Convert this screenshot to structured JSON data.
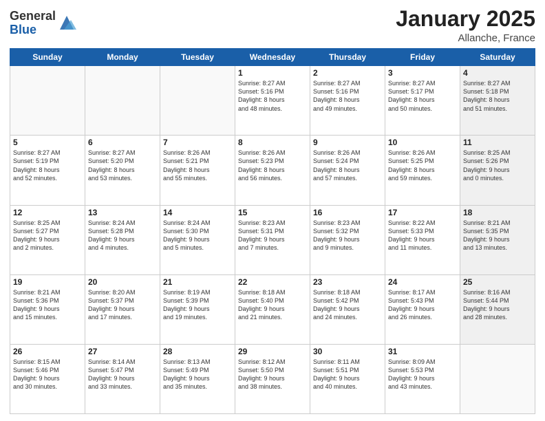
{
  "header": {
    "logo_general": "General",
    "logo_blue": "Blue",
    "month": "January 2025",
    "location": "Allanche, France"
  },
  "weekdays": [
    "Sunday",
    "Monday",
    "Tuesday",
    "Wednesday",
    "Thursday",
    "Friday",
    "Saturday"
  ],
  "weeks": [
    [
      {
        "day": "",
        "info": "",
        "empty": true
      },
      {
        "day": "",
        "info": "",
        "empty": true
      },
      {
        "day": "",
        "info": "",
        "empty": true
      },
      {
        "day": "1",
        "info": "Sunrise: 8:27 AM\nSunset: 5:16 PM\nDaylight: 8 hours\nand 48 minutes.",
        "empty": false
      },
      {
        "day": "2",
        "info": "Sunrise: 8:27 AM\nSunset: 5:16 PM\nDaylight: 8 hours\nand 49 minutes.",
        "empty": false
      },
      {
        "day": "3",
        "info": "Sunrise: 8:27 AM\nSunset: 5:17 PM\nDaylight: 8 hours\nand 50 minutes.",
        "empty": false
      },
      {
        "day": "4",
        "info": "Sunrise: 8:27 AM\nSunset: 5:18 PM\nDaylight: 8 hours\nand 51 minutes.",
        "empty": false,
        "shaded": true
      }
    ],
    [
      {
        "day": "5",
        "info": "Sunrise: 8:27 AM\nSunset: 5:19 PM\nDaylight: 8 hours\nand 52 minutes.",
        "empty": false
      },
      {
        "day": "6",
        "info": "Sunrise: 8:27 AM\nSunset: 5:20 PM\nDaylight: 8 hours\nand 53 minutes.",
        "empty": false
      },
      {
        "day": "7",
        "info": "Sunrise: 8:26 AM\nSunset: 5:21 PM\nDaylight: 8 hours\nand 55 minutes.",
        "empty": false
      },
      {
        "day": "8",
        "info": "Sunrise: 8:26 AM\nSunset: 5:23 PM\nDaylight: 8 hours\nand 56 minutes.",
        "empty": false
      },
      {
        "day": "9",
        "info": "Sunrise: 8:26 AM\nSunset: 5:24 PM\nDaylight: 8 hours\nand 57 minutes.",
        "empty": false
      },
      {
        "day": "10",
        "info": "Sunrise: 8:26 AM\nSunset: 5:25 PM\nDaylight: 8 hours\nand 59 minutes.",
        "empty": false
      },
      {
        "day": "11",
        "info": "Sunrise: 8:25 AM\nSunset: 5:26 PM\nDaylight: 9 hours\nand 0 minutes.",
        "empty": false,
        "shaded": true
      }
    ],
    [
      {
        "day": "12",
        "info": "Sunrise: 8:25 AM\nSunset: 5:27 PM\nDaylight: 9 hours\nand 2 minutes.",
        "empty": false
      },
      {
        "day": "13",
        "info": "Sunrise: 8:24 AM\nSunset: 5:28 PM\nDaylight: 9 hours\nand 4 minutes.",
        "empty": false
      },
      {
        "day": "14",
        "info": "Sunrise: 8:24 AM\nSunset: 5:30 PM\nDaylight: 9 hours\nand 5 minutes.",
        "empty": false
      },
      {
        "day": "15",
        "info": "Sunrise: 8:23 AM\nSunset: 5:31 PM\nDaylight: 9 hours\nand 7 minutes.",
        "empty": false
      },
      {
        "day": "16",
        "info": "Sunrise: 8:23 AM\nSunset: 5:32 PM\nDaylight: 9 hours\nand 9 minutes.",
        "empty": false
      },
      {
        "day": "17",
        "info": "Sunrise: 8:22 AM\nSunset: 5:33 PM\nDaylight: 9 hours\nand 11 minutes.",
        "empty": false
      },
      {
        "day": "18",
        "info": "Sunrise: 8:21 AM\nSunset: 5:35 PM\nDaylight: 9 hours\nand 13 minutes.",
        "empty": false,
        "shaded": true
      }
    ],
    [
      {
        "day": "19",
        "info": "Sunrise: 8:21 AM\nSunset: 5:36 PM\nDaylight: 9 hours\nand 15 minutes.",
        "empty": false
      },
      {
        "day": "20",
        "info": "Sunrise: 8:20 AM\nSunset: 5:37 PM\nDaylight: 9 hours\nand 17 minutes.",
        "empty": false
      },
      {
        "day": "21",
        "info": "Sunrise: 8:19 AM\nSunset: 5:39 PM\nDaylight: 9 hours\nand 19 minutes.",
        "empty": false
      },
      {
        "day": "22",
        "info": "Sunrise: 8:18 AM\nSunset: 5:40 PM\nDaylight: 9 hours\nand 21 minutes.",
        "empty": false
      },
      {
        "day": "23",
        "info": "Sunrise: 8:18 AM\nSunset: 5:42 PM\nDaylight: 9 hours\nand 24 minutes.",
        "empty": false
      },
      {
        "day": "24",
        "info": "Sunrise: 8:17 AM\nSunset: 5:43 PM\nDaylight: 9 hours\nand 26 minutes.",
        "empty": false
      },
      {
        "day": "25",
        "info": "Sunrise: 8:16 AM\nSunset: 5:44 PM\nDaylight: 9 hours\nand 28 minutes.",
        "empty": false,
        "shaded": true
      }
    ],
    [
      {
        "day": "26",
        "info": "Sunrise: 8:15 AM\nSunset: 5:46 PM\nDaylight: 9 hours\nand 30 minutes.",
        "empty": false
      },
      {
        "day": "27",
        "info": "Sunrise: 8:14 AM\nSunset: 5:47 PM\nDaylight: 9 hours\nand 33 minutes.",
        "empty": false
      },
      {
        "day": "28",
        "info": "Sunrise: 8:13 AM\nSunset: 5:49 PM\nDaylight: 9 hours\nand 35 minutes.",
        "empty": false
      },
      {
        "day": "29",
        "info": "Sunrise: 8:12 AM\nSunset: 5:50 PM\nDaylight: 9 hours\nand 38 minutes.",
        "empty": false
      },
      {
        "day": "30",
        "info": "Sunrise: 8:11 AM\nSunset: 5:51 PM\nDaylight: 9 hours\nand 40 minutes.",
        "empty": false
      },
      {
        "day": "31",
        "info": "Sunrise: 8:09 AM\nSunset: 5:53 PM\nDaylight: 9 hours\nand 43 minutes.",
        "empty": false
      },
      {
        "day": "",
        "info": "",
        "empty": true,
        "shaded": true
      }
    ]
  ]
}
